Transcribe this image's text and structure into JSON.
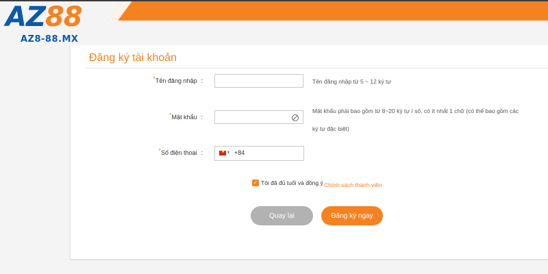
{
  "colors": {
    "accent": "#f58220",
    "brand_blue": "#0c5aa6",
    "button_gray": "#b2b2b2"
  },
  "logo": {
    "mark_prefix": "AZ",
    "mark_suffix": "88",
    "domain": "AZ8-88.MX"
  },
  "form": {
    "title": "Đăng ký tài khoản",
    "required_mark": "*",
    "colon": ":",
    "username": {
      "label": "Tên đăng nhập",
      "value": "",
      "hint": "Tên đăng nhập từ 5 ~ 12 ký tự"
    },
    "password": {
      "label": "Mật khẩu",
      "value": "",
      "hint_line1": "Mật khẩu phải bao gồm từ 8~20 ký tự / số, có ít nhất 1 chữ (có thể bao gồm các",
      "hint_line2": "ký tự đặc biệt)",
      "toggle_icon": "eye-off-icon"
    },
    "phone": {
      "label": "Số điện thoại",
      "country_flag": "vietnam-flag-icon",
      "dial_code": "+84",
      "value": ""
    },
    "agreement": {
      "checked": true,
      "text": "Tôi đã đủ tuổi và đồng ý",
      "link": "Chính sách thành viên"
    },
    "buttons": {
      "back": "Quay lại",
      "register": "Đăng ký ngay"
    }
  }
}
